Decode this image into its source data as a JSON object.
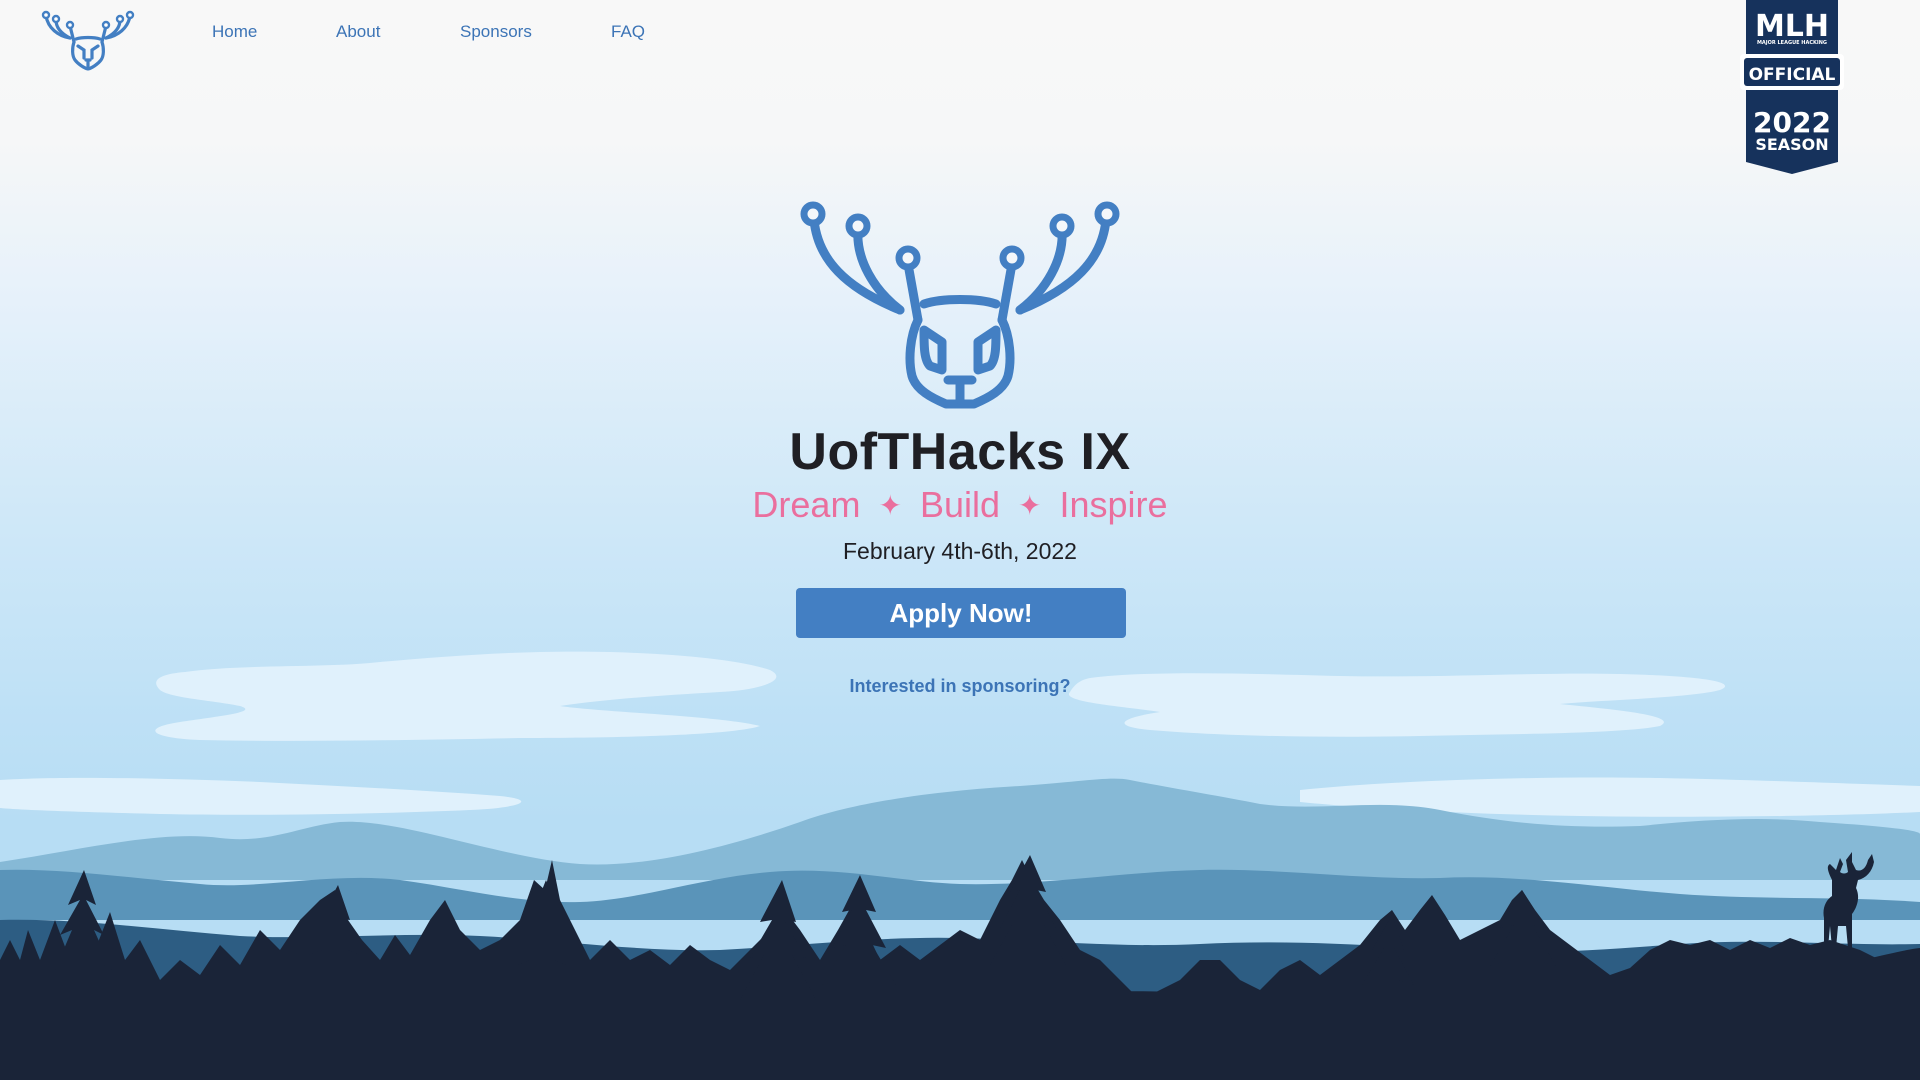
{
  "nav": {
    "logo_icon": "antler-deer-icon",
    "links": [
      {
        "label": "Home"
      },
      {
        "label": "About"
      },
      {
        "label": "Sponsors"
      },
      {
        "label": "FAQ"
      }
    ]
  },
  "mlh_badge": {
    "brand": "MLH",
    "sub": "MAJOR LEAGUE HACKING",
    "ribbon": "OFFICIAL",
    "year": "2022",
    "season": "SEASON"
  },
  "hero": {
    "logo_icon": "antler-deer-icon",
    "title": "UofTHacks IX",
    "tagline": {
      "words": [
        "Dream",
        "Build",
        "Inspire"
      ],
      "separator": "✦"
    },
    "date": "February 4th-6th, 2022",
    "apply_label": "Apply Now!",
    "sponsor_link": "Interested in sponsoring?"
  },
  "colors": {
    "accent": "#437fc3",
    "tagline": "#ea6f9e",
    "title": "#1f1f24",
    "badge": "#16325c"
  }
}
